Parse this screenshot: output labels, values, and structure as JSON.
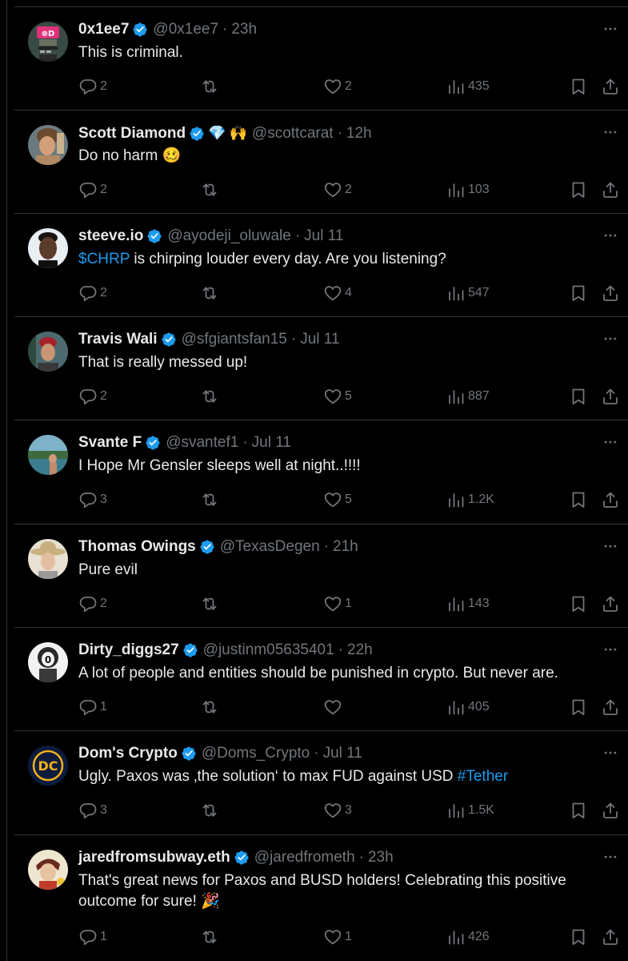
{
  "tweets": [
    {
      "name": "0x1ee7",
      "verified": true,
      "emojis": [],
      "handle": "@0x1ee7",
      "time": "23h",
      "text": [
        {
          "t": "This is criminal."
        }
      ],
      "replies": "2",
      "retweets": "",
      "likes": "2",
      "views": "435"
    },
    {
      "name": "Scott Diamond",
      "verified": true,
      "emojis": [
        "💎",
        "🙌"
      ],
      "handle": "@scottcarat",
      "time": "12h",
      "text": [
        {
          "t": "Do no harm 🥴"
        }
      ],
      "replies": "2",
      "retweets": "",
      "likes": "2",
      "views": "103"
    },
    {
      "name": "steeve.io",
      "verified": true,
      "emojis": [],
      "handle": "@ayodeji_oluwale",
      "time": "Jul 11",
      "text": [
        {
          "t": "$CHRP",
          "link": true
        },
        {
          "t": " is chirping louder every day. Are you listening?"
        }
      ],
      "replies": "2",
      "retweets": "",
      "likes": "4",
      "views": "547"
    },
    {
      "name": "Travis Wali",
      "verified": true,
      "emojis": [],
      "handle": "@sfgiantsfan15",
      "time": "Jul 11",
      "text": [
        {
          "t": "That is really messed up!"
        }
      ],
      "replies": "2",
      "retweets": "",
      "likes": "5",
      "views": "887"
    },
    {
      "name": "Svante F",
      "verified": true,
      "emojis": [],
      "handle": "@svantef1",
      "time": "Jul 11",
      "text": [
        {
          "t": "I Hope Mr Gensler sleeps well at night..!!!!"
        }
      ],
      "replies": "3",
      "retweets": "",
      "likes": "5",
      "views": "1.2K"
    },
    {
      "name": "Thomas Owings",
      "verified": true,
      "emojis": [],
      "handle": "@TexasDegen",
      "time": "21h",
      "text": [
        {
          "t": "Pure evil"
        }
      ],
      "replies": "2",
      "retweets": "",
      "likes": "1",
      "views": "143"
    },
    {
      "name": "Dirty_diggs27",
      "verified": true,
      "emojis": [],
      "handle": "@justinm05635401",
      "time": "22h",
      "text": [
        {
          "t": "A lot of people and entities should be punished in crypto. But never are."
        }
      ],
      "replies": "1",
      "retweets": "",
      "likes": "",
      "views": "405"
    },
    {
      "name": "Dom's Crypto",
      "verified": true,
      "emojis": [],
      "handle": "@Doms_Crypto",
      "time": "Jul 11",
      "text": [
        {
          "t": "Ugly. Paxos was ‚the solution‘ to max FUD against USD "
        },
        {
          "t": "#Tether",
          "link": true
        }
      ],
      "replies": "3",
      "retweets": "",
      "likes": "3",
      "views": "1.5K"
    },
    {
      "name": "jaredfromsubway.eth",
      "verified": true,
      "emojis": [],
      "handle": "@jaredfrometh",
      "time": "23h",
      "text": [
        {
          "t": "That's great news for Paxos and BUSD holders! Celebrating this positive outcome for sure! 🎉"
        }
      ],
      "replies": "1",
      "retweets": "",
      "likes": "1",
      "views": "426"
    }
  ],
  "colors": {
    "background": "#000000",
    "text": "#e7e9ea",
    "muted": "#71767b",
    "link": "#1d9bf0",
    "verified": "#1d9bf0",
    "divider": "#2f3336"
  },
  "icons": {
    "verified": "verified-badge-icon",
    "more": "more-options-icon",
    "reply": "reply-icon",
    "retweet": "retweet-icon",
    "like": "like-icon",
    "views": "views-icon",
    "bookmark": "bookmark-icon",
    "share": "share-icon"
  }
}
